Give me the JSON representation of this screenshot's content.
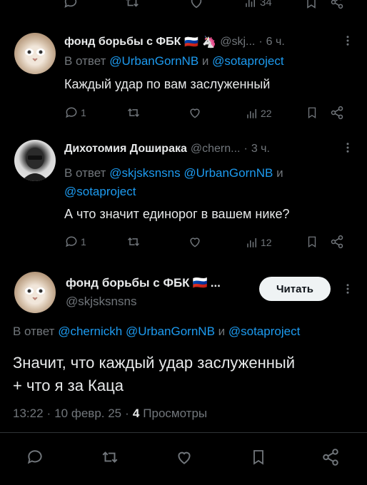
{
  "top_actions": {
    "views": "34"
  },
  "tweet1": {
    "display_name": "фонд борьбы с ФБК",
    "flag": "🇷🇺",
    "unicorn": "🦄",
    "handle": "@skj...",
    "dot": "·",
    "time": "6 ч.",
    "reply_prefix": "В ответ",
    "reply_user1": "@UrbanGornNB",
    "reply_and": "и",
    "reply_user2": "@sotaproject",
    "text": "Каждый удар по вам заслуженный",
    "replies": "1",
    "views": "22"
  },
  "tweet2": {
    "display_name": "Дихотомия Доширака",
    "handle": "@chern...",
    "dot": "·",
    "time": "3 ч.",
    "reply_prefix": "В ответ",
    "reply_user1": "@skjsksnsns",
    "reply_user2": "@UrbanGornNB",
    "reply_and": "и",
    "reply_user3": "@sotaproject",
    "text": "А что значит единорог в вашем нике?",
    "replies": "1",
    "views": "12"
  },
  "main_tweet": {
    "display_name": "фонд борьбы с ФБК",
    "flag": "🇷🇺",
    "ellipsis": "...",
    "handle": "@skjsksnsns",
    "follow_label": "Читать",
    "reply_prefix": "В ответ",
    "reply_user1": "@chernickh",
    "reply_user2": "@UrbanGornNB",
    "reply_and": "и",
    "reply_user3": "@sotaproject",
    "text_line1": "Значит, что каждый удар заслуженный",
    "text_line2": "+ что я за Каца",
    "time": "13:22",
    "dot": "·",
    "date": "10 февр. 25",
    "views_count": "4",
    "views_label": "Просмотры"
  },
  "icons": [
    "reply-icon",
    "retweet-icon",
    "like-icon",
    "views-icon",
    "bookmark-icon",
    "share-icon",
    "more-icon"
  ],
  "colors": {
    "background": "#000000",
    "text": "#e7e9ea",
    "secondary": "#71767b",
    "link": "#1d9bf0",
    "button_bg": "#eff3f4"
  }
}
